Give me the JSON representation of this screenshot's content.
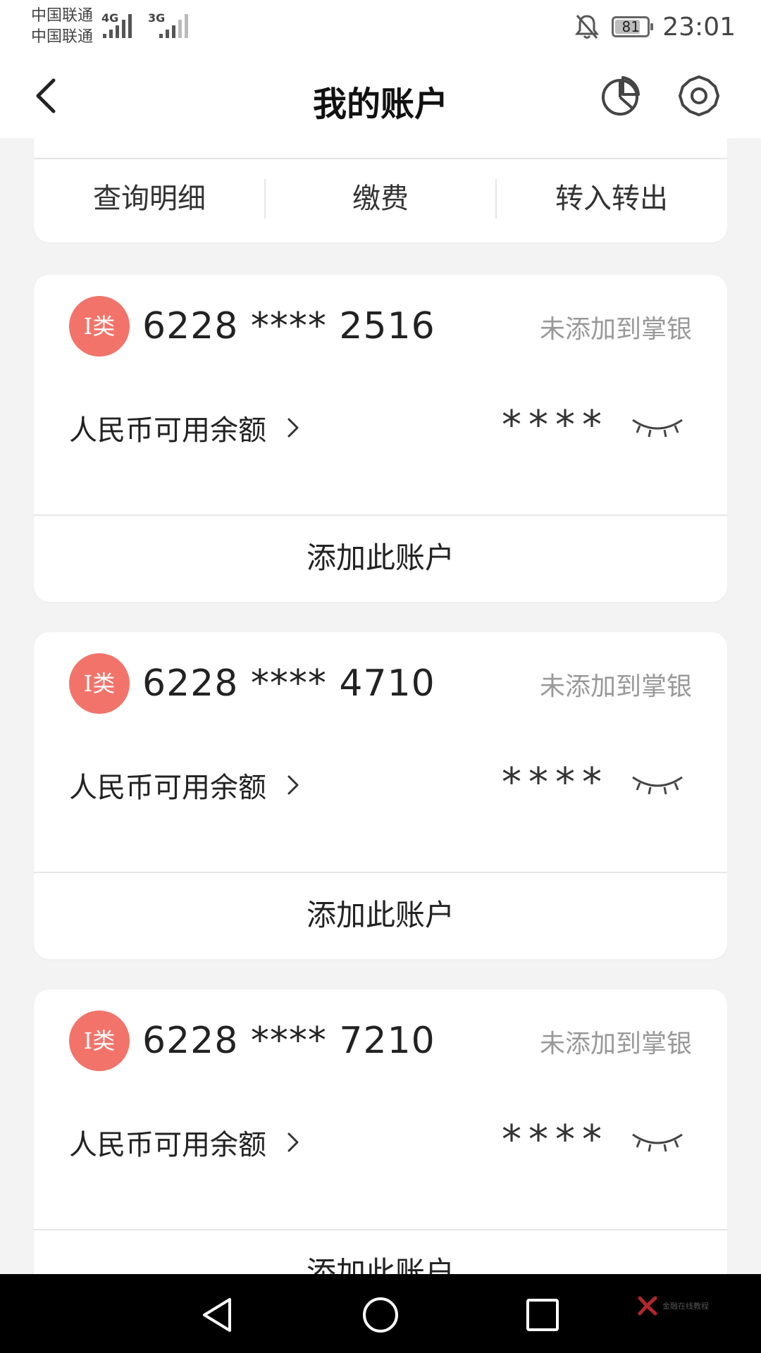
{
  "status_bar": {
    "carrier_1": "中国联通",
    "carrier_2": "中国联通",
    "net_1": "4G",
    "net_2": "3G",
    "battery_level": 81,
    "battery_text": "81",
    "time": "23:01"
  },
  "header": {
    "title": "我的账户"
  },
  "top_actions": [
    {
      "label": "查询明细"
    },
    {
      "label": "缴费"
    },
    {
      "label": "转入转出"
    }
  ],
  "accounts": [
    {
      "badge": "I类",
      "number": "6228 **** 2516",
      "status": "未添加到掌银",
      "balance_label": "人民币可用余额",
      "balance_masked": "****",
      "add_label": "添加此账户"
    },
    {
      "badge": "I类",
      "number": "6228 **** 4710",
      "status": "未添加到掌银",
      "balance_label": "人民币可用余额",
      "balance_masked": "****",
      "add_label": "添加此账户"
    },
    {
      "badge": "I类",
      "number": "6228 **** 7210",
      "status": "未添加到掌银",
      "balance_label": "人民币可用余额",
      "balance_masked": "****",
      "add_label": "添加此账户"
    }
  ],
  "watermark": {
    "text": "金融在线教程"
  },
  "colors": {
    "badge": "#f2736a",
    "background": "#f3f3f3",
    "muted_text": "#999999"
  }
}
